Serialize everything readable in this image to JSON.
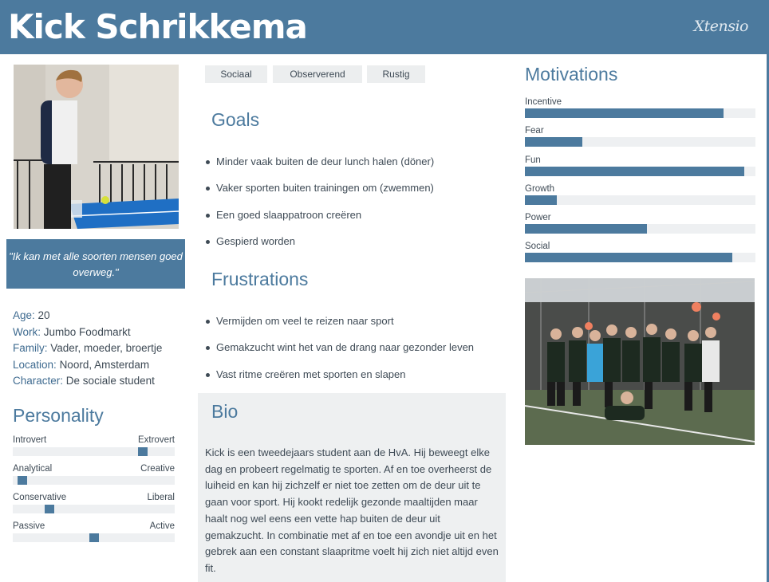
{
  "header": {
    "title": "Kick Schrikkema",
    "brand": "Xtensio"
  },
  "quote": "\"Ik kan met alle soorten mensen goed overweg.\"",
  "facts": [
    {
      "label": "Age:",
      "value": "20"
    },
    {
      "label": "Work:",
      "value": "Jumbo Foodmarkt"
    },
    {
      "label": "Family:",
      "value": "Vader, moeder, broertje"
    },
    {
      "label": "Location:",
      "value": "Noord, Amsterdam"
    },
    {
      "label": "Character:",
      "value": "De sociale student"
    }
  ],
  "personality": {
    "title": "Personality",
    "sliders": [
      {
        "left": "Introvert",
        "right": "Extrovert",
        "level": 0.82
      },
      {
        "left": "Analytical",
        "right": "Creative",
        "level": 0.03
      },
      {
        "left": "Conservative",
        "right": "Liberal",
        "level": 0.21
      },
      {
        "left": "Passive",
        "right": "Active",
        "level": 0.5
      }
    ]
  },
  "tags": [
    "Sociaal",
    "Observerend",
    "Rustig"
  ],
  "goals": {
    "title": "Goals",
    "items": [
      "Minder vaak buiten de deur lunch halen (döner)",
      "Vaker sporten buiten trainingen om (zwemmen)",
      "Een goed slaappatroon creëren",
      "Gespierd worden"
    ]
  },
  "frustrations": {
    "title": "Frustrations",
    "items": [
      "Vermijden om veel te reizen naar sport",
      "Gemakzucht wint het van de drang naar gezonder leven",
      "Vast ritme creëren met sporten en slapen"
    ]
  },
  "bio": {
    "title": "Bio",
    "text": "Kick is een tweedejaars student aan de HvA. Hij beweegt elke dag en probeert regelmatig te sporten. Af en toe overheerst de luiheid en kan hij zichzelf er niet toe zetten om de deur uit te gaan voor sport. Hij kookt redelijk gezonde maaltijden maar haalt nog wel eens een vette hap buiten de deur uit gemakzucht. In combinatie met af en toe een avondje uit en het gebrek aan een constant slaapritme voelt hij zich niet altijd even fit."
  },
  "motivations": {
    "title": "Motivations",
    "items": [
      {
        "label": "Incentive",
        "level": 0.86
      },
      {
        "label": "Fear",
        "level": 0.25
      },
      {
        "label": "Fun",
        "level": 0.95
      },
      {
        "label": "Growth",
        "level": 0.14
      },
      {
        "label": "Power",
        "level": 0.53
      },
      {
        "label": "Social",
        "level": 0.9
      }
    ]
  },
  "colors": {
    "accent": "#4c7a9e",
    "track": "#eef0f2",
    "bio_bg": "#eef0f1",
    "text": "#3e4a55"
  }
}
